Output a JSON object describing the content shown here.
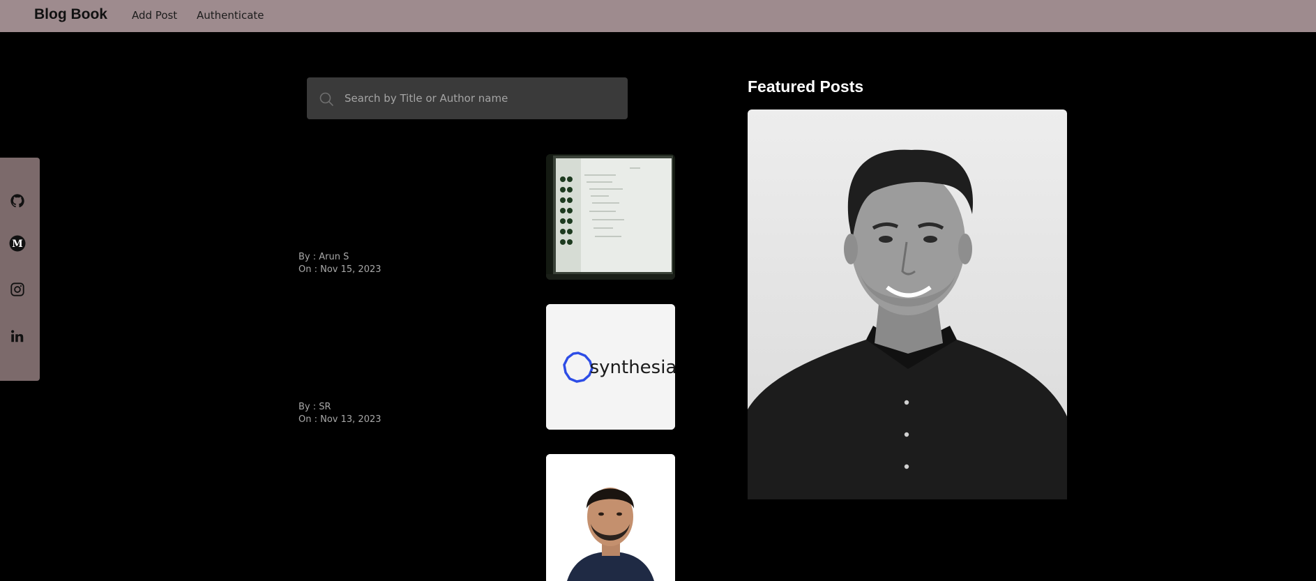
{
  "navbar": {
    "brand": "Blog Book",
    "links": [
      "Add Post",
      "Authenticate"
    ]
  },
  "social": {
    "icons": [
      "github-icon",
      "medium-icon",
      "instagram-icon",
      "linkedin-icon"
    ]
  },
  "search": {
    "placeholder": "Search by Title or Author name",
    "value": ""
  },
  "posts": [
    {
      "by": "By : Arun S",
      "on": "On : Nov 15, 2023",
      "thumbnail": "screen-photo"
    },
    {
      "by": "By : SR",
      "on": "On : Nov 13, 2023",
      "thumbnail": "synthesia-logo",
      "logo_text": "synthesia"
    },
    {
      "by": "",
      "on": "",
      "thumbnail": "portrait-photo"
    }
  ],
  "featured": {
    "title": "Featured Posts"
  },
  "colors": {
    "navbar_bg": "#9e8b8e",
    "sidebar_bg": "#7c6a6b",
    "page_bg": "#000000",
    "search_bg": "#3a3a3a",
    "synthesia_blue": "#2d4de6"
  }
}
